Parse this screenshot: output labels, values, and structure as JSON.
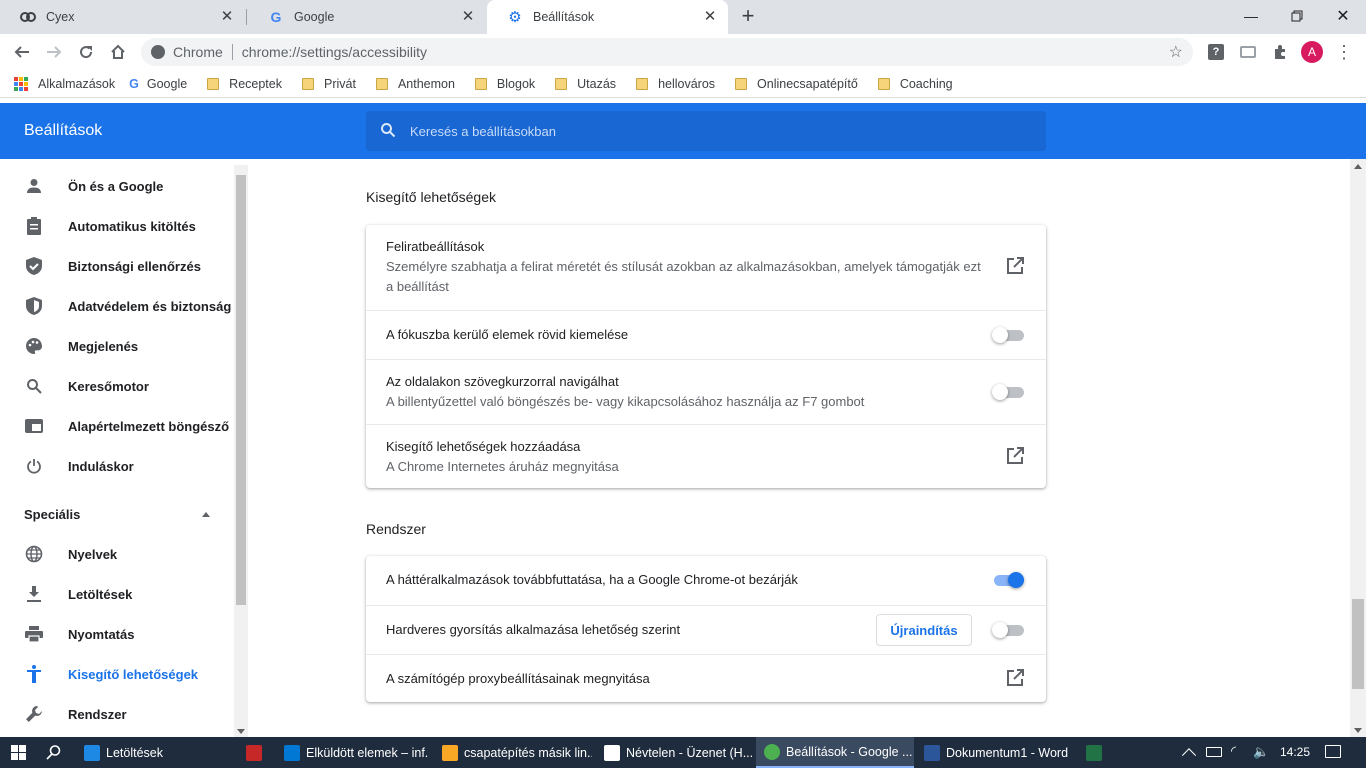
{
  "tabs": [
    {
      "label": "Cyex"
    },
    {
      "label": "Google"
    },
    {
      "label": "Beállítások"
    }
  ],
  "omnibox": {
    "site_label": "Chrome",
    "url": "chrome://settings/accessibility"
  },
  "profile_initial": "A",
  "bookmarks": [
    "Alkalmazások",
    "Google",
    "Receptek",
    "Privát",
    "Anthemon",
    "Blogok",
    "Utazás",
    "hellováros",
    "Onlinecsapatépítő",
    "Coaching"
  ],
  "header": {
    "title": "Beállítások",
    "search_placeholder": "Keresés a beállításokban"
  },
  "sidebar": {
    "items": [
      {
        "label": "Ön és a Google",
        "icon": "person-icon"
      },
      {
        "label": "Automatikus kitöltés",
        "icon": "clipboard-icon"
      },
      {
        "label": "Biztonsági ellenőrzés",
        "icon": "shield-check-icon"
      },
      {
        "label": "Adatvédelem és biztonság",
        "icon": "shield-half-icon"
      },
      {
        "label": "Megjelenés",
        "icon": "palette-icon"
      },
      {
        "label": "Keresőmotor",
        "icon": "search-icon"
      },
      {
        "label": "Alapértelmezett böngésző",
        "icon": "browser-icon"
      },
      {
        "label": "Induláskor",
        "icon": "power-icon"
      }
    ],
    "advanced_label": "Speciális",
    "advanced_items": [
      {
        "label": "Nyelvek",
        "icon": "globe-icon"
      },
      {
        "label": "Letöltések",
        "icon": "download-icon"
      },
      {
        "label": "Nyomtatás",
        "icon": "printer-icon"
      },
      {
        "label": "Kisegítő lehetőségek",
        "icon": "accessibility-icon",
        "selected": true
      },
      {
        "label": "Rendszer",
        "icon": "wrench-icon"
      }
    ]
  },
  "accessibility": {
    "heading": "Kisegítő lehetőségek",
    "rows": [
      {
        "title": "Feliratbeállítások",
        "subtitle": "Személyre szabhatja a felirat méretét és stílusát azokban az alkalmazásokban, amelyek támogatják ezt a beállítást"
      },
      {
        "title": "A fókuszba kerülő elemek rövid kiemelése",
        "toggle": false
      },
      {
        "title": "Az oldalakon szövegkurzorral navigálhat",
        "subtitle": "A billentyűzettel való böngészés be- vagy kikapcsolásához használja az F7 gombot",
        "toggle": false
      },
      {
        "title": "Kisegítő lehetőségek hozzáadása",
        "subtitle": "A Chrome Internetes áruház megnyitása"
      }
    ]
  },
  "system": {
    "heading": "Rendszer",
    "rows": [
      {
        "title": "A háttéralkalmazások továbbfuttatása, ha a Google Chrome-ot bezárják",
        "toggle": true
      },
      {
        "title": "Hardveres gyorsítás alkalmazása lehetőség szerint",
        "button": "Újraindítás",
        "toggle": false
      },
      {
        "title": "A számítógép proxybeállításainak megnyitása"
      }
    ]
  },
  "taskbar": {
    "items": [
      {
        "label": "Letöltések",
        "color": "#1e88e5"
      },
      {
        "label": "",
        "color": "#c62828"
      },
      {
        "label": "Elküldött elemek – inf...",
        "color": "#0078d4"
      },
      {
        "label": "csapatépítés másik lin...",
        "color": "#f9a825"
      },
      {
        "label": "Névtelen - Üzenet (H...",
        "color": "#ffffff"
      },
      {
        "label": "Beállítások - Google ...",
        "color": "#4caf50"
      },
      {
        "label": "Dokumentum1 - Word",
        "color": "#2b579a"
      },
      {
        "label": "",
        "color": "#217346"
      }
    ],
    "time": "14:25"
  },
  "colors": {
    "accent": "#1a73e8",
    "header": "#1a73e8",
    "taskbar": "#1f2c3e"
  }
}
